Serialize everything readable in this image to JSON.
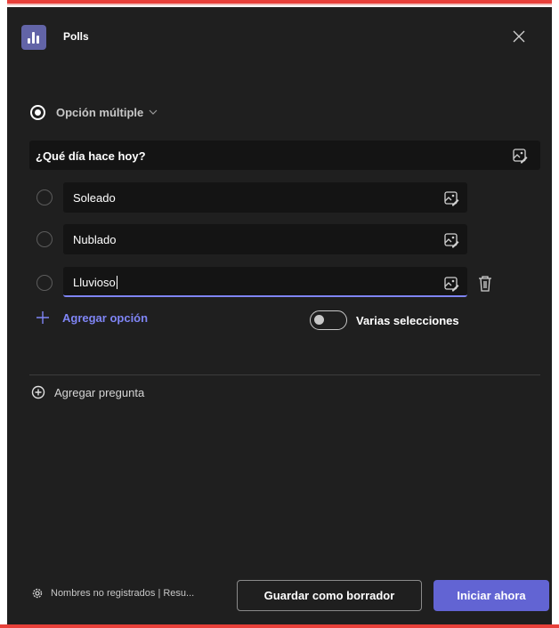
{
  "app": {
    "title": "Polls",
    "icon": "bar-chart-icon",
    "accent": "#6264a7"
  },
  "header": {
    "close_icon": "close-icon"
  },
  "question_type": {
    "label": "Opción múltiple",
    "icon": "radio-selected-icon",
    "chevron": "chevron-down-icon"
  },
  "question": {
    "text": "¿Qué día hace hoy?",
    "image_icon": "add-image-icon"
  },
  "options": [
    {
      "label": "Soleado"
    },
    {
      "label": "Nublado"
    },
    {
      "label": "Lluvioso"
    }
  ],
  "add_option": {
    "label": "Agregar opción",
    "icon": "plus-icon"
  },
  "multiple_select": {
    "label": "Varias selecciones",
    "enabled": false
  },
  "add_question": {
    "label": "Agregar pregunta",
    "icon": "add-circle-icon"
  },
  "footer": {
    "settings_label": "Nombres no registrados | Resu...",
    "settings_icon": "gear-icon",
    "draft_label": "Guardar como borrador",
    "start_label": "Iniciar ahora",
    "start_color": "#6264d3"
  }
}
